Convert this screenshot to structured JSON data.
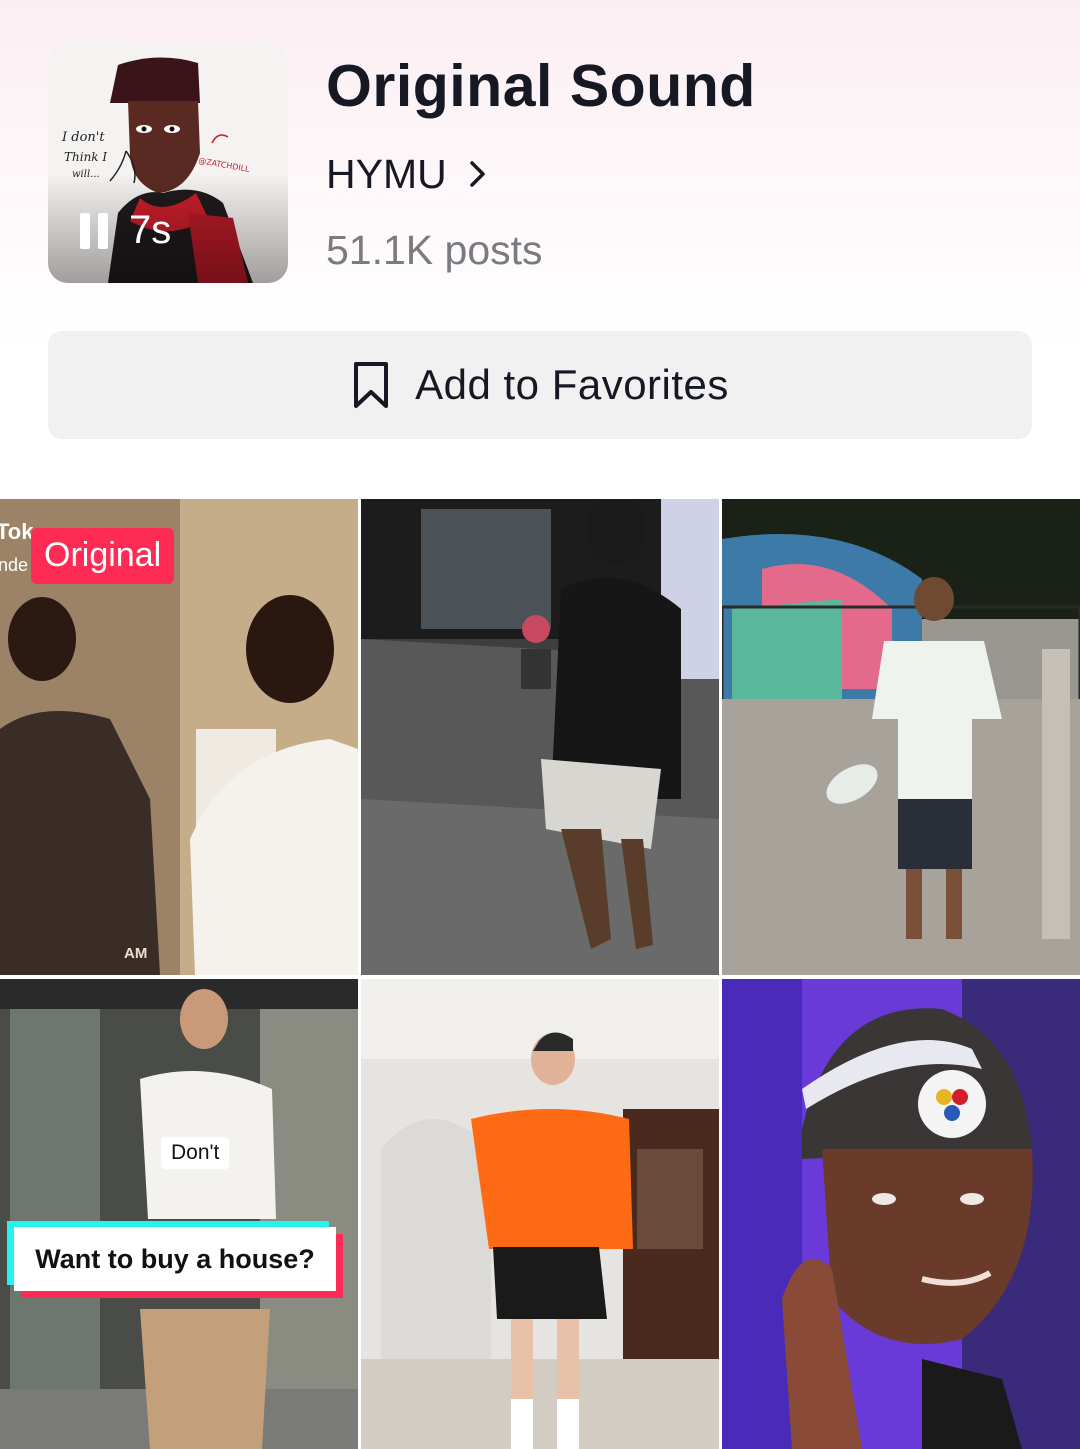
{
  "sound": {
    "title": "Original Sound",
    "artist": "HYMU",
    "posts": "51.1K posts",
    "duration": "7s",
    "cover_text": {
      "handwriting_line1": "I don't",
      "handwriting_line2": "Think I",
      "handwriting_line3": "will...",
      "signature": "@ZATCHDILL"
    }
  },
  "actions": {
    "favorite_label": "Add to Favorites",
    "favorite_icon": "bookmark-icon"
  },
  "icons": {
    "artist_link": "chevron-right-icon",
    "playback": "pause-icon"
  },
  "videos": [
    {
      "badge": "Original",
      "overlay_line1": "Tok",
      "overlay_line2": "nde",
      "corner_text": "AM"
    },
    {},
    {},
    {
      "caption_small": "Don't",
      "caption_main": "Want to buy a house?"
    },
    {},
    {}
  ],
  "colors": {
    "accent": "#fe2c55",
    "cyan": "#25f4ee",
    "text_primary": "#161823",
    "text_secondary": "#7a7b80",
    "button_bg": "#f1f1f2"
  }
}
